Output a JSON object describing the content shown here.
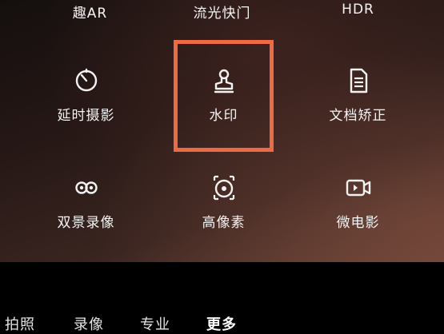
{
  "top_row": [
    {
      "label": "趣AR"
    },
    {
      "label": "流光快门"
    },
    {
      "label": "HDR"
    }
  ],
  "grid": [
    {
      "label": "延时摄影",
      "icon": "timer-icon"
    },
    {
      "label": "水印",
      "icon": "stamp-icon"
    },
    {
      "label": "文档矫正",
      "icon": "document-icon"
    },
    {
      "label": "双景录像",
      "icon": "dual-view-icon"
    },
    {
      "label": "高像素",
      "icon": "high-pixel-icon"
    },
    {
      "label": "微电影",
      "icon": "video-icon"
    }
  ],
  "modes": [
    {
      "label": "拍照"
    },
    {
      "label": "录像"
    },
    {
      "label": "专业"
    },
    {
      "label": "更多",
      "active": true
    }
  ],
  "highlight_color": "#ee6a45"
}
